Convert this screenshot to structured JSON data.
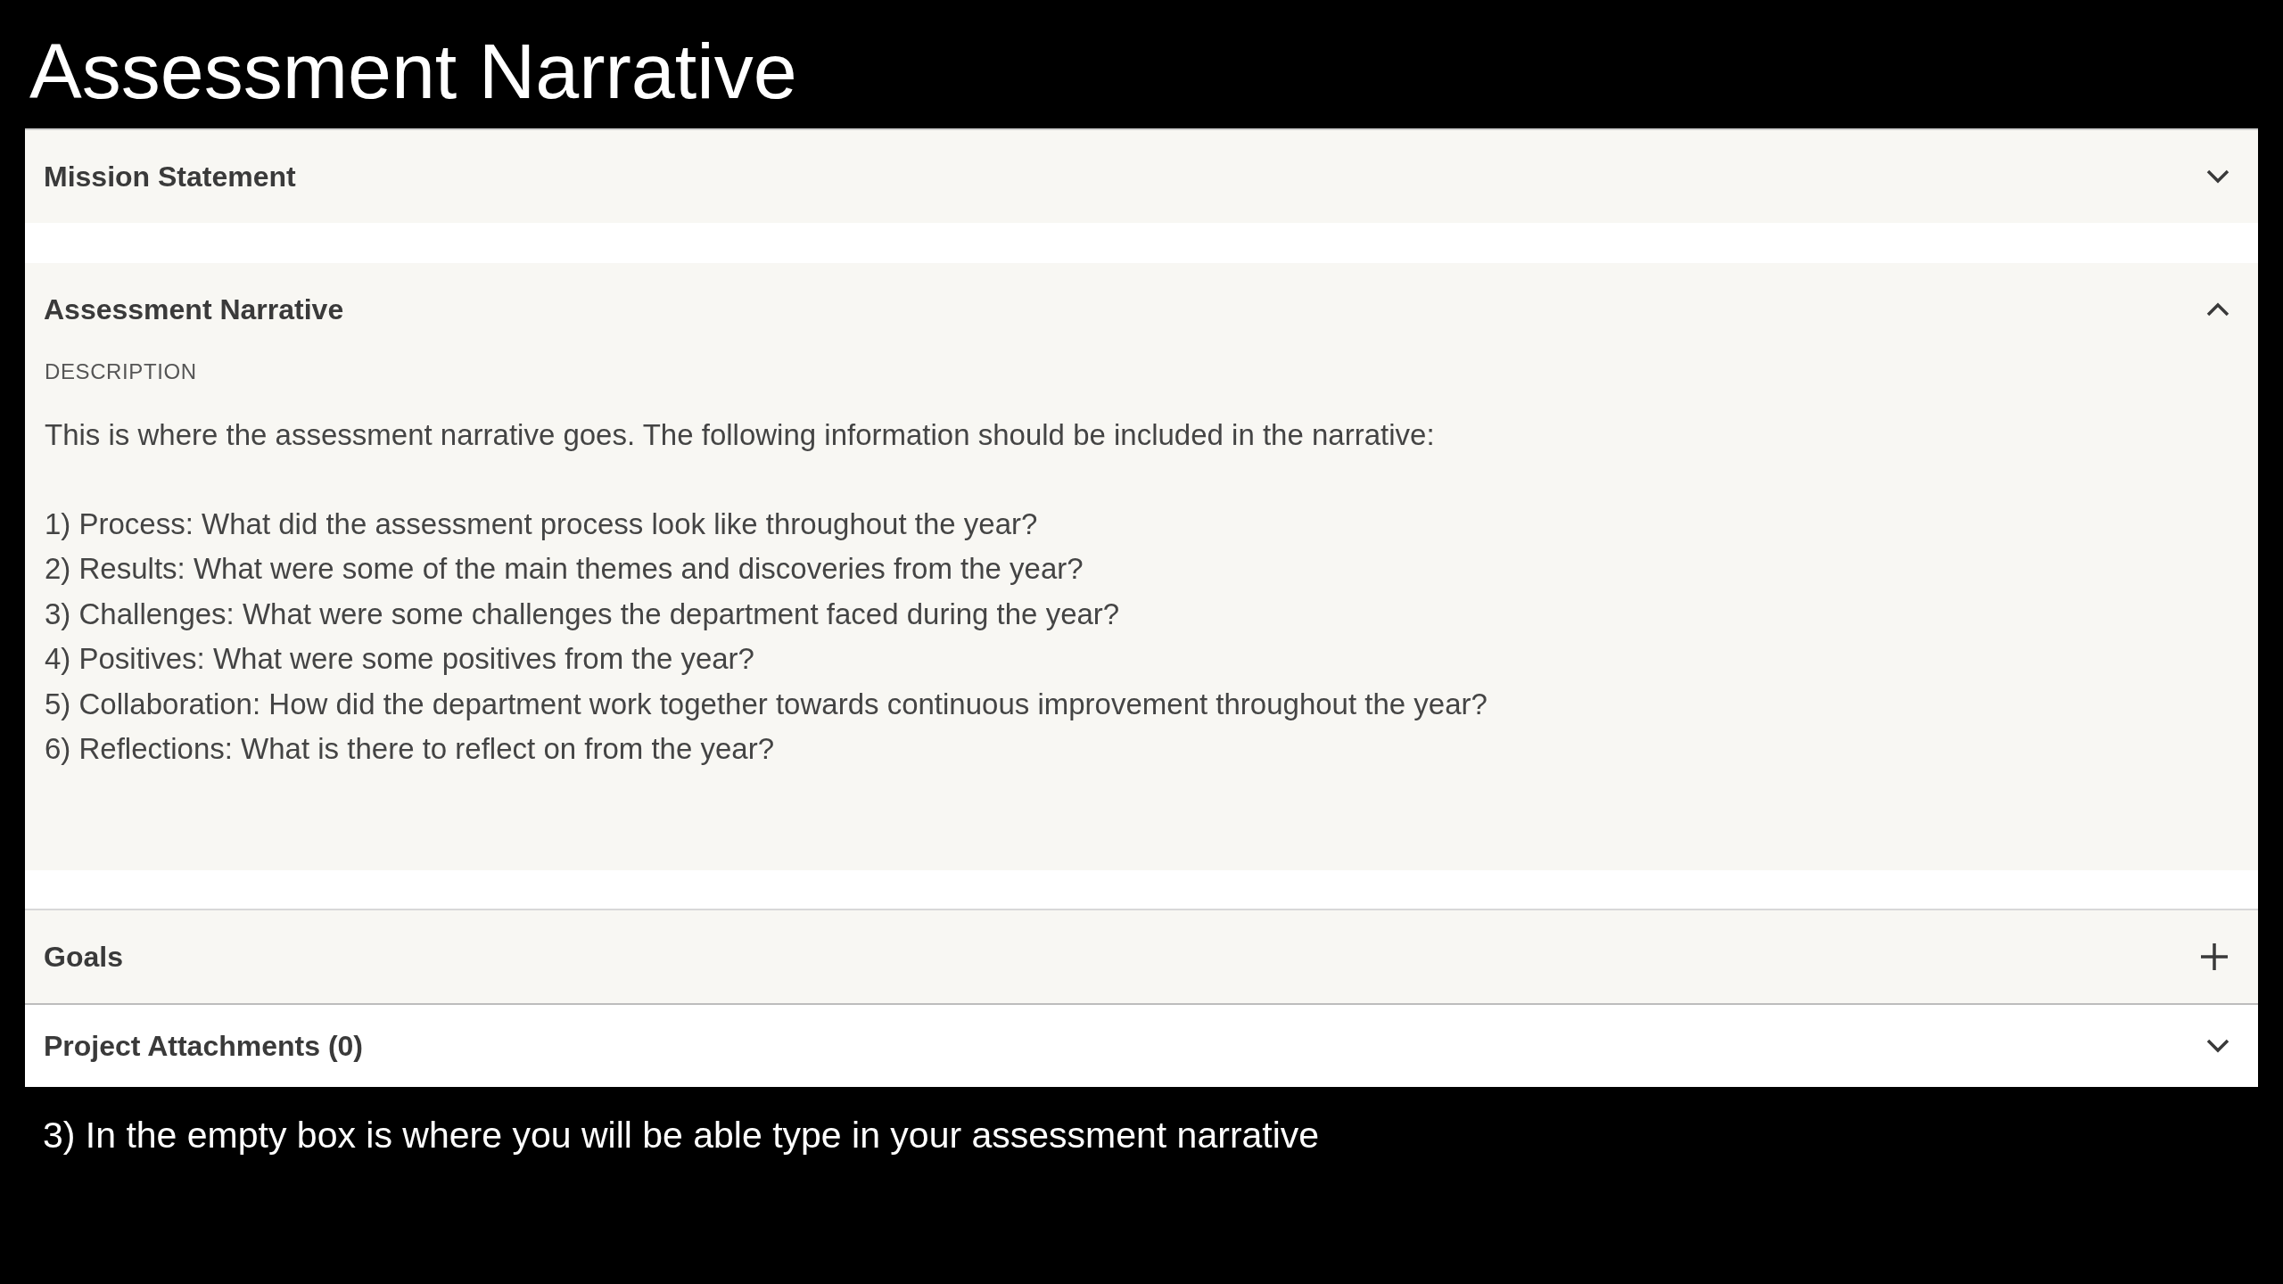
{
  "slide_title": "Assessment Narrative",
  "sections": [
    {
      "title": "Mission Statement",
      "kind": "chevron",
      "expanded": false,
      "highlighted": true
    },
    {
      "title": "Assessment Narrative",
      "kind": "chevron",
      "expanded": true,
      "highlighted": true,
      "description_label": "DESCRIPTION",
      "intro": "This is where the assessment narrative goes. The following information should be included in the narrative:",
      "items": [
        "1) Process: What did the assessment process look like throughout the year?",
        "2) Results: What were some of the main themes and discoveries from the year?",
        "3) Challenges: What were some challenges the department faced during the year?",
        "4) Positives: What were some positives from the year?",
        "5) Collaboration: How did the department work together towards continuous improvement throughout the year?",
        "6) Reflections: What is there to reflect on from the year?"
      ]
    },
    {
      "title": "Goals",
      "kind": "plus",
      "expanded": false,
      "highlighted": true
    },
    {
      "title": "Project Attachments (0)",
      "kind": "chevron",
      "expanded": false,
      "highlighted": false
    }
  ],
  "caption": "3) In the empty box is where you will be able type in your assessment narrative"
}
